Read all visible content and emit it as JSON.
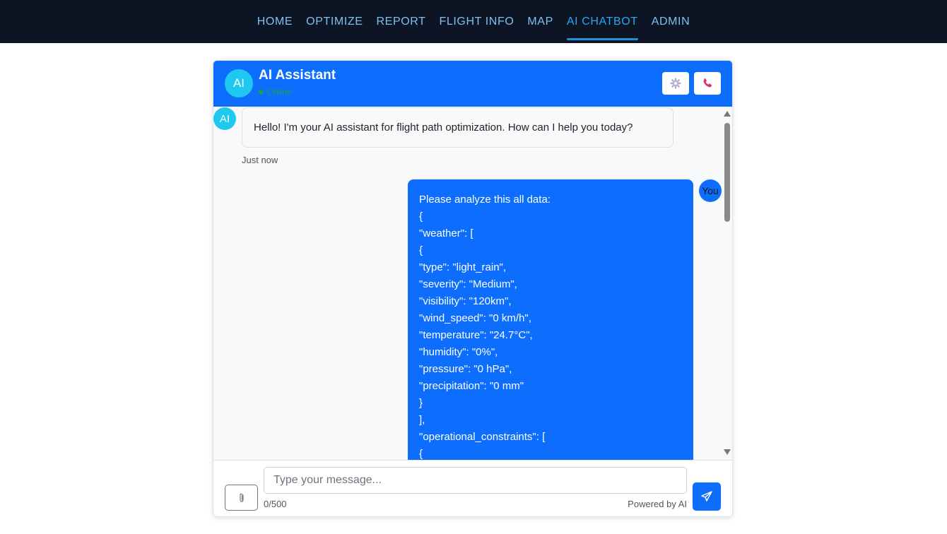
{
  "nav": {
    "items": [
      {
        "label": "HOME"
      },
      {
        "label": "OPTIMIZE"
      },
      {
        "label": "REPORT"
      },
      {
        "label": "FLIGHT INFO"
      },
      {
        "label": "MAP"
      },
      {
        "label": "AI CHATBOT",
        "active": true
      },
      {
        "label": "ADMIN"
      }
    ]
  },
  "chat": {
    "avatar_text": "AI",
    "title": "AI Assistant",
    "status": "Online",
    "settings_icon": "gear-icon",
    "call_icon": "phone-icon"
  },
  "messages": {
    "ai": {
      "avatar": "AI",
      "text": "Hello! I'm your AI assistant for flight path optimization. How can I help you today?",
      "time": "Just now"
    },
    "user": {
      "avatar": "You",
      "lines": [
        "Please analyze this all data:",
        "{",
        "\"weather\": [",
        "{",
        "\"type\": \"light_rain\",",
        "\"severity\": \"Medium\",",
        "\"visibility\": \"120km\",",
        "\"wind_speed\": \"0 km/h\",",
        "\"temperature\": \"24.7°C\",",
        "\"humidity\": \"0%\",",
        "\"pressure\": \"0 hPa\",",
        "\"precipitation\": \"0 mm\"",
        "}",
        "],",
        "\"operational_constraints\": [",
        "{"
      ]
    }
  },
  "input": {
    "placeholder": "Type your message...",
    "counter": "0/500",
    "powered_by": "Powered by AI"
  },
  "colors": {
    "nav_bg": "#0d1424",
    "primary": "#0d6efd",
    "ai_avatar": "#1ec8ee",
    "online": "#18a34a"
  }
}
